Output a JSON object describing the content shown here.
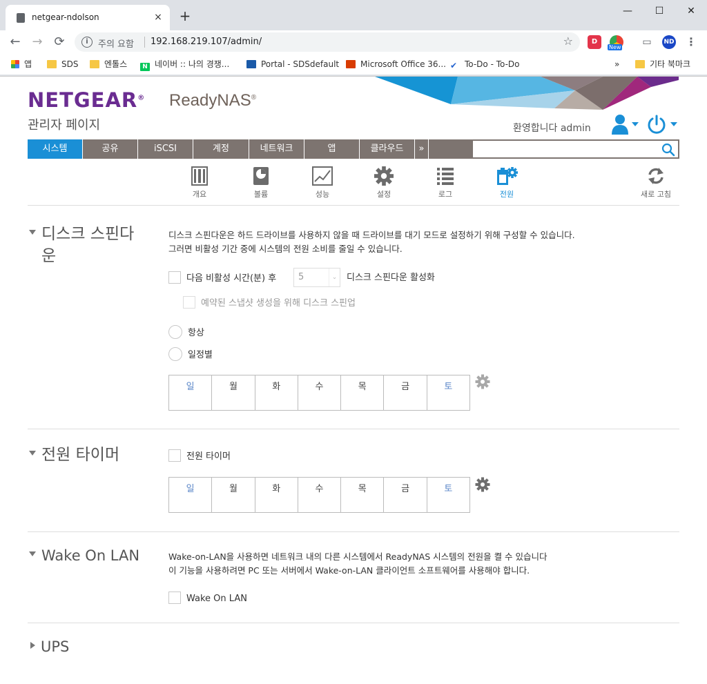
{
  "browser": {
    "tab_title": "netgear-ndolson",
    "tab_close": "×",
    "new_tab": "+",
    "win_min": "—",
    "win_max": "☐",
    "win_close": "✕",
    "nav_back": "←",
    "nav_forward": "→",
    "nav_reload": "⟳",
    "info_symbol": "i",
    "security_warning": "주의 요함",
    "url": "192.168.219.107/admin/",
    "star": "☆",
    "ext_d": "D",
    "ext_new": "New",
    "ext_cast": "▭",
    "ext_avatar": "ND",
    "menu_dots": "⋮",
    "naver_letter": "N",
    "todo_check": "✔",
    "bookmarks": [
      "앱",
      "SDS",
      "엔톨스",
      "네이버 :: 나의 경쟁...",
      "Portal - SDSdefault",
      "Microsoft Office 36...",
      "To-Do - To-Do"
    ],
    "bookmarks_more": "»",
    "other_bookmarks": "기타 북마크"
  },
  "header": {
    "logo": "NETGEAR",
    "logo_mark": "®",
    "product": "ReadyNAS",
    "product_mark": "®",
    "subtitle": "관리자 페이지",
    "welcome": "환영합니다 admin"
  },
  "nav": {
    "tabs": [
      "시스템",
      "공유",
      "iSCSI",
      "계정",
      "네트워크",
      "앱",
      "클라우드"
    ],
    "more": "»",
    "search_placeholder": ""
  },
  "subnav": {
    "items": [
      "개요",
      "볼륨",
      "성능",
      "설정",
      "로그",
      "전원"
    ],
    "active": "전원",
    "refresh": "새로 고침"
  },
  "spindown": {
    "title_line1": "디스크 스핀다",
    "title_line2": "운",
    "desc_line1": "디스크 스핀다운은 하드 드라이브를 사용하지 않을 때 드라이브를 대기 모드로 설정하기 위해 구성할 수 있습니다.",
    "desc_line2": "그러면 비활성 기간 중에 시스템의 전원 소비를 줄일 수 있습니다.",
    "idle_label": "다음 비활성 시간(분) 후",
    "idle_value": "5",
    "idle_dd": "⌄",
    "enable_label": "디스크 스핀다운 활성화",
    "snapshot_label": "예약된 스냅샷 생성을 위해 디스크 스핀업",
    "radio_always": "항상",
    "radio_schedule": "일정별"
  },
  "days": [
    "일",
    "월",
    "화",
    "수",
    "목",
    "금",
    "토"
  ],
  "power_timer": {
    "title": "전원 타이머",
    "checkbox_label": "전원 타이머"
  },
  "wol": {
    "title": "Wake On LAN",
    "desc_line1": "Wake-on-LAN을 사용하면 네트워크 내의 다른 시스템에서 ReadyNAS 시스템의 전원을 켤 수 있습니다",
    "desc_line2": "이 기능을 사용하려면 PC 또는 서버에서 Wake-on-LAN 클라이언트 소프트웨어를 사용해야 합니다.",
    "checkbox_label": "Wake On LAN"
  },
  "ups": {
    "title": "UPS"
  },
  "colors": {
    "accent": "#1a8fd6",
    "brand": "#6a2c91",
    "navbar": "#7d7470"
  }
}
